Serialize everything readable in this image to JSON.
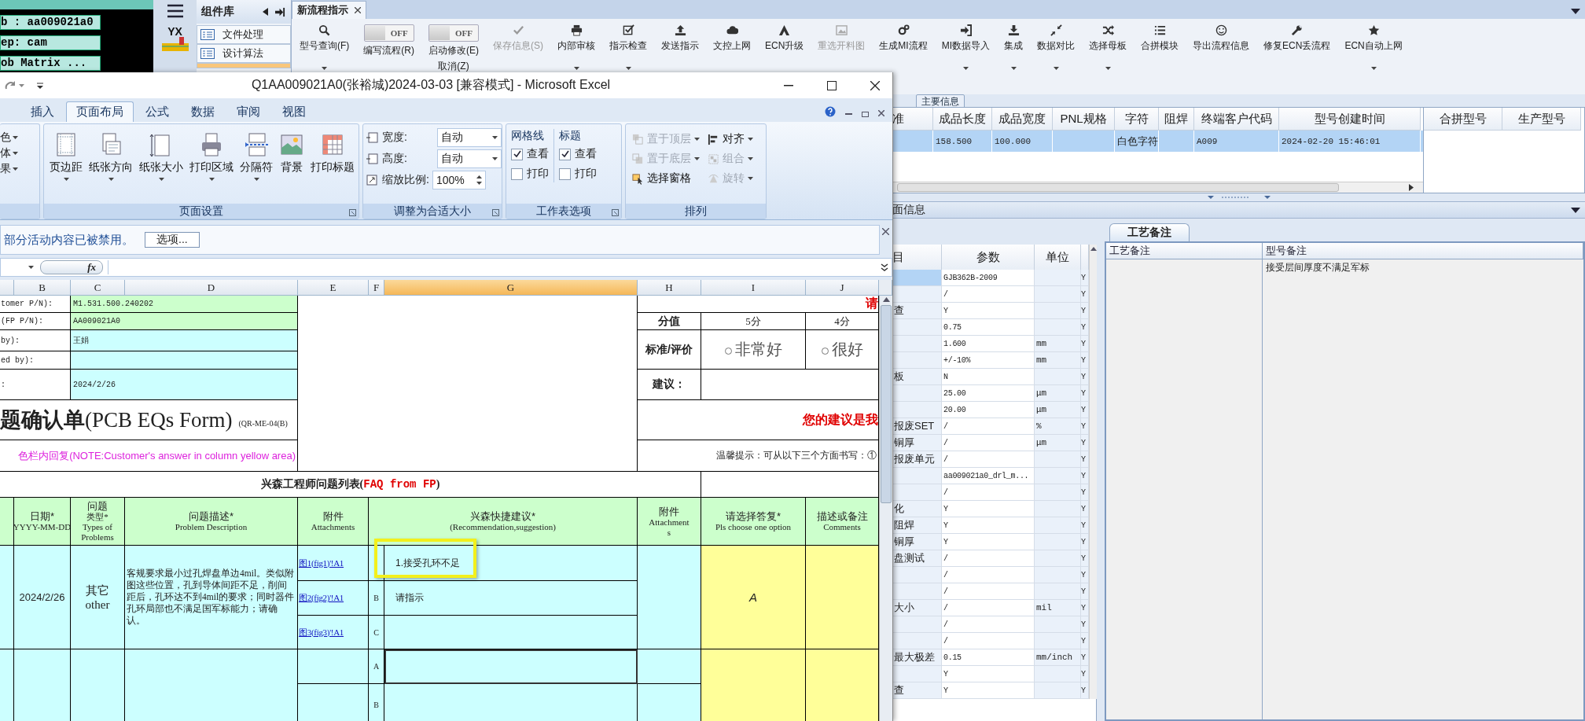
{
  "terminal": {
    "lines": [
      "b : aa009021a0",
      "ep: cam",
      "ob Matrix ..."
    ]
  },
  "logo": {
    "text": "YX"
  },
  "component_library": {
    "title": "组件库",
    "items": [
      {
        "label": "文件处理",
        "selected": false
      },
      {
        "label": "设计算法",
        "selected": false
      }
    ]
  },
  "tabs": [
    {
      "label": "新流程指示",
      "selected": true
    }
  ],
  "toolbar": [
    {
      "kind": "button",
      "label": "型号查询(F)",
      "dropdown": true,
      "disabled": false
    },
    {
      "kind": "toggle",
      "switch_text": "OFF",
      "on": false,
      "label": "编写流程(R)"
    },
    {
      "kind": "toggle",
      "switch_text": "OFF",
      "on": false,
      "label": "启动修改(E)",
      "label2": "取消(Z)"
    },
    {
      "kind": "button",
      "label": "保存信息(S)",
      "dropdown": false,
      "disabled": true
    },
    {
      "kind": "button",
      "label": "内部审核",
      "dropdown": true,
      "disabled": false
    },
    {
      "kind": "button",
      "label": "指示检查",
      "dropdown": true,
      "disabled": false
    },
    {
      "kind": "button",
      "label": "发送指示",
      "dropdown": false,
      "disabled": false
    },
    {
      "kind": "button",
      "label": "文控上网",
      "dropdown": false,
      "disabled": false
    },
    {
      "kind": "button",
      "label": "ECN升级",
      "dropdown": false,
      "disabled": false
    },
    {
      "kind": "button",
      "label": "重选开料图",
      "dropdown": false,
      "disabled": true
    },
    {
      "kind": "button",
      "label": "生成MI流程",
      "dropdown": false,
      "disabled": false
    },
    {
      "kind": "button",
      "label": "MI数据导入",
      "dropdown": true,
      "disabled": false
    },
    {
      "kind": "button",
      "label": "集成",
      "dropdown": true,
      "disabled": false
    },
    {
      "kind": "button",
      "label": "数据对比",
      "dropdown": true,
      "disabled": false
    },
    {
      "kind": "button",
      "label": "选择母板",
      "dropdown": true,
      "disabled": false
    },
    {
      "kind": "button",
      "label": "合拼模块",
      "dropdown": false,
      "disabled": false
    },
    {
      "kind": "button",
      "label": "导出流程信息",
      "dropdown": false,
      "disabled": false
    },
    {
      "kind": "button",
      "label": "修复ECN丢流程",
      "dropdown": false,
      "disabled": false
    },
    {
      "kind": "button",
      "label": "ECN自动上网",
      "dropdown": true,
      "disabled": false
    }
  ],
  "main_info": {
    "title": "主要信息",
    "columns": [
      "准",
      "成品长度",
      "成品宽度",
      "PNL规格",
      "字符",
      "阻焊",
      "终端客户代码",
      "型号创建时间"
    ],
    "rows": [
      {
        "selected": true,
        "cells": [
          null,
          "158.500",
          "100.000",
          null,
          "白色字符",
          null,
          "A009",
          "2024-02-20 15:46:01"
        ]
      }
    ]
  },
  "merge_table": {
    "columns": [
      "合拼型号",
      "生产型号"
    ]
  },
  "section": {
    "title": "面信息"
  },
  "params": {
    "columns": [
      "目",
      "参数",
      "单位"
    ],
    "rows": [
      {
        "label": null,
        "value": "GJB362B-2009",
        "unit": null,
        "flag": "Y",
        "selected": true
      },
      {
        "label": null,
        "value": "/",
        "unit": null,
        "flag": "Y",
        "selected": false
      },
      {
        "label": "查",
        "value": "Y",
        "unit": null,
        "flag": "Y",
        "selected": false
      },
      {
        "label": null,
        "value": "0.75",
        "unit": null,
        "flag": "Y",
        "selected": false
      },
      {
        "label": null,
        "value": "1.600",
        "unit": "mm",
        "flag": "Y",
        "selected": false
      },
      {
        "label": null,
        "value": "+/-10%",
        "unit": "mm",
        "flag": "Y",
        "selected": false
      },
      {
        "label": "板",
        "value": "N",
        "unit": null,
        "flag": "Y",
        "selected": false
      },
      {
        "label": null,
        "value": "25.00",
        "unit": "μm",
        "flag": "Y",
        "selected": false
      },
      {
        "label": null,
        "value": "20.00",
        "unit": "μm",
        "flag": "Y",
        "selected": false
      },
      {
        "label": "报废SET",
        "value": "/",
        "unit": "%",
        "flag": "Y",
        "selected": false
      },
      {
        "label": "铜厚",
        "value": "/",
        "unit": "μm",
        "flag": "Y",
        "selected": false
      },
      {
        "label": "报废单元",
        "value": "/",
        "unit": null,
        "flag": "Y",
        "selected": false
      },
      {
        "label": null,
        "value": "aa009021a0_drl_m...",
        "unit": null,
        "flag": "Y",
        "selected": false
      },
      {
        "label": null,
        "value": "/",
        "unit": null,
        "flag": "Y",
        "selected": false
      },
      {
        "label": "化",
        "value": "Y",
        "unit": null,
        "flag": "Y",
        "selected": false
      },
      {
        "label": "阻焊",
        "value": "Y",
        "unit": null,
        "flag": "Y",
        "selected": false
      },
      {
        "label": "铜厚",
        "value": "Y",
        "unit": null,
        "flag": "Y",
        "selected": false
      },
      {
        "label": "盘测试",
        "value": "/",
        "unit": null,
        "flag": "Y",
        "selected": false
      },
      {
        "label": null,
        "value": "/",
        "unit": null,
        "flag": "Y",
        "selected": false
      },
      {
        "label": null,
        "value": "/",
        "unit": null,
        "flag": "Y",
        "selected": false
      },
      {
        "label": "大小",
        "value": "/",
        "unit": "mil",
        "flag": "Y",
        "selected": false
      },
      {
        "label": null,
        "value": "/",
        "unit": null,
        "flag": "Y",
        "selected": false
      },
      {
        "label": null,
        "value": "/",
        "unit": null,
        "flag": "Y",
        "selected": false
      },
      {
        "label": "最大极差",
        "value": "0.15",
        "unit": "mm/inch",
        "flag": "Y",
        "selected": false
      },
      {
        "label": null,
        "value": "Y",
        "unit": null,
        "flag": "Y",
        "selected": false
      },
      {
        "label": "查",
        "value": "Y",
        "unit": null,
        "flag": "Y",
        "selected": false
      }
    ]
  },
  "notes": {
    "tab": {
      "label": "工艺备注",
      "selected": true
    },
    "columns": [
      "工艺备注",
      "型号备注"
    ],
    "model_note": "接受层间厚度不满足军标"
  },
  "excel": {
    "title": "Q1AA009021A0(张裕城)2024-03-03  [兼容模式] - Microsoft Excel",
    "ribbon_tabs": [
      {
        "label": "插入",
        "selected": false
      },
      {
        "label": "页面布局",
        "selected": true
      },
      {
        "label": "公式",
        "selected": false
      },
      {
        "label": "数据",
        "selected": false
      },
      {
        "label": "审阅",
        "selected": false
      },
      {
        "label": "视图",
        "selected": false
      }
    ],
    "partial_group": [
      "色",
      "体",
      "果"
    ],
    "page_setup": {
      "title": "页面设置",
      "buttons": [
        {
          "label": "页边距",
          "dropdown": true
        },
        {
          "label": "纸张方向",
          "dropdown": true
        },
        {
          "label": "纸张大小",
          "dropdown": true
        },
        {
          "label": "打印区域",
          "dropdown": true
        },
        {
          "label": "分隔符",
          "dropdown": true
        },
        {
          "label": "背景",
          "dropdown": false
        },
        {
          "label": "打印标题",
          "dropdown": false
        }
      ]
    },
    "scale_to_fit": {
      "title": "调整为合适大小",
      "fields": [
        {
          "label": "宽度:",
          "value": "自动"
        },
        {
          "label": "高度:",
          "value": "自动"
        }
      ],
      "scale_label": "缩放比例:",
      "scale_value": "100%"
    },
    "sheet_options": {
      "title": "工作表选项",
      "groups": [
        {
          "title": "网格线",
          "options": [
            {
              "label": "查看",
              "checked": true
            },
            {
              "label": "打印",
              "checked": false
            }
          ]
        },
        {
          "title": "标题",
          "options": [
            {
              "label": "查看",
              "checked": true
            },
            {
              "label": "打印",
              "checked": false
            }
          ]
        }
      ]
    },
    "arrange": {
      "title": "排列",
      "items": [
        {
          "label": "置于顶层",
          "disabled": true
        },
        {
          "label": "对齐",
          "disabled": false
        },
        {
          "label": "置于底层",
          "disabled": true
        },
        {
          "label": "组合",
          "disabled": true
        },
        {
          "label": "选择窗格",
          "disabled": false
        },
        {
          "label": "旋转",
          "disabled": true
        }
      ]
    },
    "security_bar": {
      "message": "部分活动内容已被禁用。",
      "button": "选项..."
    },
    "formula_bar": {
      "function_label": "fx"
    },
    "columns": [
      {
        "label": "B",
        "selected": false
      },
      {
        "label": "C",
        "selected": false
      },
      {
        "label": "D",
        "selected": false
      },
      {
        "label": "E",
        "selected": false
      },
      {
        "label": "F",
        "selected": false
      },
      {
        "label": "G",
        "selected": true
      },
      {
        "label": "H",
        "selected": false
      },
      {
        "label": "I",
        "selected": false
      },
      {
        "label": "J",
        "selected": false
      }
    ],
    "cells": [
      {
        "kind": "label",
        "text": "tomer P/N):"
      },
      {
        "kind": "value",
        "text": "M1.531.500.240202"
      },
      {
        "kind": "label",
        "text": "(FP P/N):"
      },
      {
        "kind": "value",
        "text": "AA009021A0"
      },
      {
        "kind": "label",
        "text": "by):"
      },
      {
        "kind": "value",
        "text": "王娟"
      },
      {
        "kind": "label",
        "text": "ed by):"
      },
      {
        "kind": "label",
        "text": ":"
      },
      {
        "kind": "value",
        "text": "2024/2/26"
      },
      {
        "kind": "title",
        "text": "**题确认单**(PCB EQs Form)",
        "suffix": "(QR-ME-04(B)"
      },
      {
        "kind": "note",
        "text": "色栏内回复(NOTE:Customer's answer in column yellow area)"
      },
      {
        "kind": "red",
        "text": "请"
      },
      {
        "kind": "bold",
        "text": "分值"
      },
      {
        "kind": "center",
        "text": "5分"
      },
      {
        "kind": "center",
        "text": "4分"
      },
      {
        "kind": "bold",
        "text": "标准/评价"
      },
      {
        "kind": "radio",
        "text": "非常好",
        "selected": false
      },
      {
        "kind": "radio",
        "text": "很好",
        "selected": false
      },
      {
        "kind": "bold",
        "text": "建议："
      },
      {
        "kind": "red",
        "text": "您的建议是我"
      },
      {
        "kind": "hint",
        "text": "温馨提示：可从以下三个方面书写：①"
      },
      {
        "kind": "heading",
        "text": "兴森工程师问题列表(**FAQ from FP**)"
      },
      {
        "kind": "header",
        "lines": [
          "日期*",
          "YYYY-MM-DD"
        ]
      },
      {
        "kind": "header",
        "lines": [
          "问题",
          "类型*",
          "Types of",
          "Problems"
        ]
      },
      {
        "kind": "header",
        "lines": [
          "问题描述*",
          "Problem Description"
        ]
      },
      {
        "kind": "header",
        "lines": [
          "附件",
          "Attachments"
        ]
      },
      {
        "kind": "header",
        "lines": [
          "兴森快捷建议*",
          "(Recommendation,suggestion)"
        ]
      },
      {
        "kind": "header",
        "lines": [
          "附件",
          "Attachment",
          "s"
        ]
      },
      {
        "kind": "header",
        "lines": [
          "请选择答复*",
          "Pls choose one option"
        ]
      },
      {
        "kind": "header",
        "lines": [
          "描述或备注",
          "Comments"
        ]
      },
      {
        "kind": "date",
        "text": "2024/2/26"
      },
      {
        "kind": "type",
        "lines": [
          "其它",
          "other"
        ]
      },
      {
        "kind": "desc",
        "text": "客规要求最小过孔焊盘单边4mil。类似附图这些位置，孔到导体间距不足，削间距后，孔环达不到4mil的要求；同时器件孔环局部也不满足国军标能力；请确认。"
      },
      {
        "kind": "link",
        "text": "图1(fig1)'!A1"
      },
      {
        "kind": "link",
        "text": "图2(fig2)'!A1"
      },
      {
        "kind": "link",
        "text": "图3(fig3)'!A1"
      },
      {
        "kind": "suggest",
        "text": "1.接受孔环不足"
      },
      {
        "kind": "letter",
        "text": "B"
      },
      {
        "kind": "suggest",
        "text": "请指示"
      },
      {
        "kind": "letter",
        "text": "C"
      },
      {
        "kind": "answer",
        "text": "A"
      },
      {
        "kind": "letter",
        "text": "A"
      },
      {
        "kind": "letter",
        "text": "B"
      },
      {
        "kind": "blank",
        "selected": true
      }
    ],
    "annotations": [
      {
        "kind": "box"
      }
    ]
  }
}
